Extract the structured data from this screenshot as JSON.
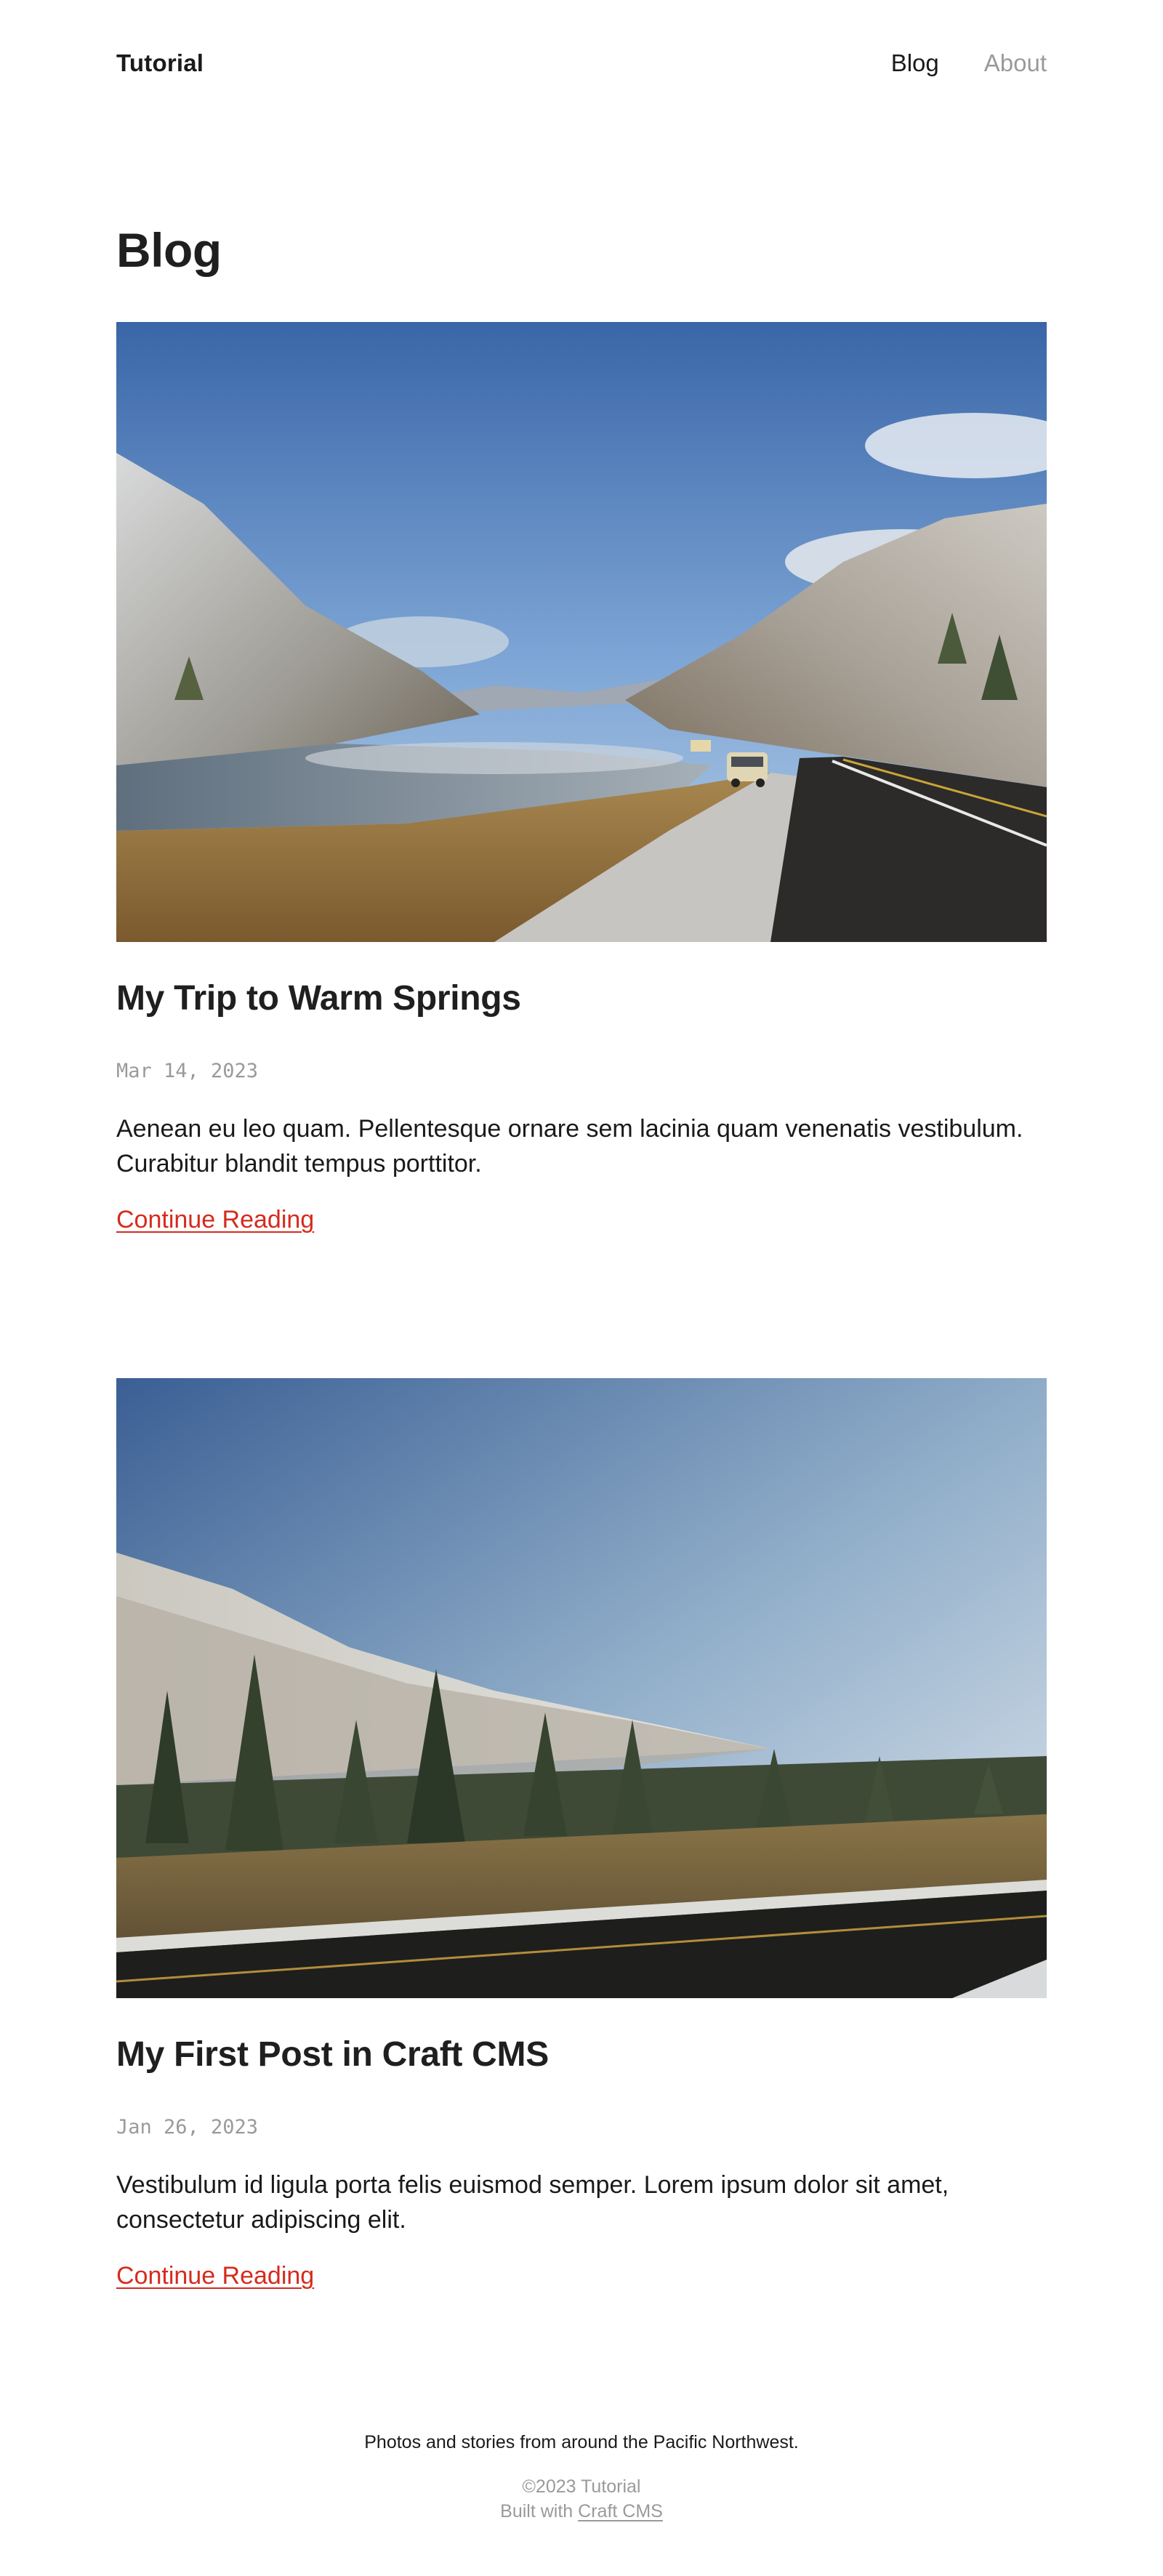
{
  "header": {
    "site_title": "Tutorial",
    "nav": [
      {
        "label": "Blog",
        "active": true
      },
      {
        "label": "About",
        "active": false
      }
    ]
  },
  "page": {
    "title": "Blog"
  },
  "posts": [
    {
      "title": "My Trip to Warm Springs",
      "date": "Mar 14, 2023",
      "excerpt": "Aenean eu leo quam. Pellentesque ornare sem lacinia quam venenatis vestibulum. Curabitur blandit tempus porttitor.",
      "link_label": "Continue Reading"
    },
    {
      "title": "My First Post in Craft CMS",
      "date": "Jan 26, 2023",
      "excerpt": "Vestibulum id ligula porta felis euismod semper. Lorem ipsum dolor sit amet, consectetur adipiscing elit.",
      "link_label": "Continue Reading"
    }
  ],
  "footer": {
    "tagline": "Photos and stories from around the Pacific Northwest.",
    "copyright": "©2023 Tutorial",
    "built_with_prefix": "Built with",
    "built_with_link": "Craft CMS"
  },
  "colors": {
    "accent_link": "#d52b1e",
    "muted_text": "#9a9a9a",
    "body_text": "#1a1a1a"
  }
}
